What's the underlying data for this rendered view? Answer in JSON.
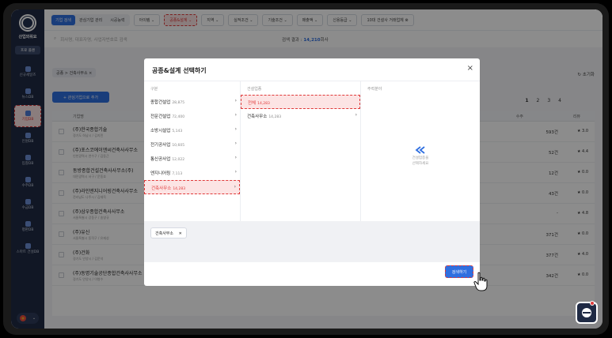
{
  "sidebar": {
    "brand": "산업외워요",
    "plan_button": "프로 플랜",
    "items": [
      {
        "label": "신규세일즈",
        "active": false
      },
      {
        "label": "뉴스DB",
        "active": false
      },
      {
        "label": "기업DB",
        "active": true
      },
      {
        "label": "인원DB",
        "active": false
      },
      {
        "label": "입찰DB",
        "active": false
      },
      {
        "label": "수주DB",
        "active": false
      },
      {
        "label": "수금DB",
        "active": false
      },
      {
        "label": "평판DB",
        "active": false
      },
      {
        "label": "스마트 건설DB",
        "active": false
      }
    ]
  },
  "topbar": {
    "tabs": [
      "기업 검색",
      "관심기업 관리",
      "시공능력"
    ],
    "active_tab": 0,
    "filters": [
      {
        "label": "아이템 ⌄",
        "highlight": false
      },
      {
        "label": "공종&설계 ⌄",
        "highlight": true
      },
      {
        "label": "지역 ⌄",
        "highlight": false
      },
      {
        "label": "실적조건 ⌄",
        "highlight": false
      },
      {
        "label": "기술조건 ⌄",
        "highlight": false
      },
      {
        "label": "매출액 ⌄",
        "highlight": false
      },
      {
        "label": "신용등급 ⌄",
        "highlight": false
      },
      {
        "label": "10대 건설사 거래업체 ⊗",
        "highlight": false
      }
    ]
  },
  "search": {
    "placeholder": "회사명, 대표자명, 사업자번호로 검색",
    "result_label": "검색 결과 :",
    "result_count": "14,210",
    "result_unit": "회사"
  },
  "breadcrumb": "공종 > 건축사무소 ×",
  "reset_label": "↻ 초기화",
  "add_button": "+ 관심기업으로 추가",
  "pager": [
    "1",
    "2",
    "3",
    "4"
  ],
  "table": {
    "headers": [
      "기업명",
      "수주",
      "리뷰"
    ],
    "rows": [
      {
        "name": "(주)한국종합기술",
        "sub": "경기도 하남시 / 김지민",
        "count": "593건",
        "rating": "3.0"
      },
      {
        "name": "(주)포스코에이앤씨건축사사무소",
        "sub": "인천광역시 연수구 / 김동근",
        "count": "52건",
        "rating": "4.4"
      },
      {
        "name": "동방종합건설건축사사무소(주)",
        "sub": "대전광역시 서구 / 문동호",
        "count": "12건",
        "rating": "0.0"
      },
      {
        "name": "(주)라인엔지니어링건축사사무소",
        "sub": "전라남도 나주시 / 김재욱",
        "count": "43건",
        "rating": "0.0"
      },
      {
        "name": "(주)삼우종합건축사사무소",
        "sub": "서울특별시 강동구 / 송영규",
        "count": "-",
        "rating": "4.8"
      },
      {
        "name": "(주)유신",
        "sub": "서울특별시 동작구 / 유재성",
        "count": "371건",
        "rating": "0.0"
      },
      {
        "name": "(주)건화",
        "sub": "경기도 안양시 / 김운석",
        "count": "377건",
        "rating": "4.0"
      },
      {
        "name": "(주)동명기술공단종합건축사사무소",
        "sub": "경기도 안양시 / 이병수",
        "count": "342건",
        "rating": "0.0"
      }
    ]
  },
  "modal": {
    "title": "공종&설계 선택하기",
    "col1_header": "구분",
    "col2_header": "건설업종",
    "col3_header": "주력분야",
    "col1_options": [
      {
        "label": "종합건설업",
        "count": "28,875",
        "selected": false
      },
      {
        "label": "전문건설업",
        "count": "72,400",
        "selected": false
      },
      {
        "label": "소방시설업",
        "count": "5,143",
        "selected": false
      },
      {
        "label": "전기공사업",
        "count": "10,605",
        "selected": false
      },
      {
        "label": "통신공사업",
        "count": "12,022",
        "selected": false
      },
      {
        "label": "엔지니어링",
        "count": "7,113",
        "selected": false
      },
      {
        "label": "건축사무소",
        "count": "14,283",
        "selected": true
      }
    ],
    "col2_options": [
      {
        "label": "전체",
        "count": "14,283",
        "selected": true
      },
      {
        "label": "건축사무소",
        "count": "14,283",
        "selected": false
      }
    ],
    "col3_placeholder_line1": "건설업종을",
    "col3_placeholder_line2": "선택하세요",
    "selected_chip": "건축사무소",
    "apply_button": "검색하기"
  },
  "colors": {
    "accent": "#2f6fe0",
    "highlight": "#e03a3a",
    "sidebar": "#1f2a44"
  }
}
